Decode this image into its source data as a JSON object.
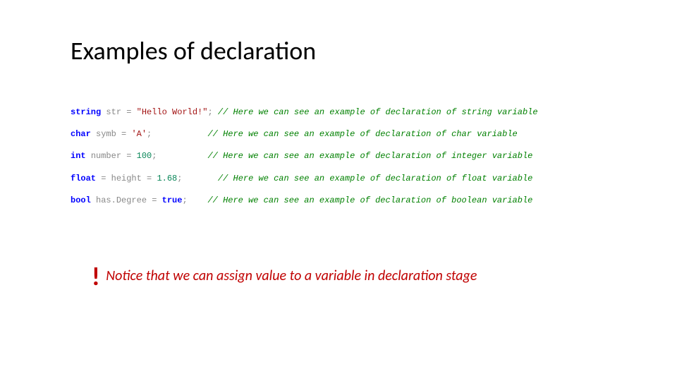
{
  "title": "Examples of declaration",
  "code": {
    "l1": {
      "kw": "string",
      "sp1": " ",
      "id": "str",
      "sp2": " ",
      "op": "=",
      "sp3": " ",
      "val": "\"Hello World!\"",
      "semi": ";",
      "pad": " ",
      "cmt": "// Here we can see an example of declaration of string variable"
    },
    "l2": {
      "kw": "char",
      "sp1": " ",
      "id": "symb",
      "sp2": " ",
      "op": "=",
      "sp3": " ",
      "val": "'A'",
      "semi": ";",
      "pad": "           ",
      "cmt": "// Here we can see an example of declaration of char variable"
    },
    "l3": {
      "kw": "int",
      "sp1": " ",
      "id": "number",
      "sp2": " ",
      "op": "=",
      "sp3": " ",
      "val": "100",
      "semi": ";",
      "pad": "          ",
      "cmt": "// Here we can see an example of declaration of integer variable"
    },
    "l4": {
      "kw": "float",
      "sp1": " ",
      "op1": "=",
      "sp2": " ",
      "id": "height",
      "sp3": " ",
      "op2": "=",
      "sp4": " ",
      "val": "1.68",
      "semi": ";",
      "pad": "       ",
      "cmt": "// Here we can see an example of declaration of float variable"
    },
    "l5": {
      "kw": "bool",
      "sp1": " ",
      "id": "has.Degree",
      "sp2": " ",
      "op": "=",
      "sp3": " ",
      "val": "true",
      "semi": ";",
      "pad": "    ",
      "cmt": "// Here we can see an example of declaration of boolean variable"
    }
  },
  "note": {
    "bang": "!",
    "text": " Notice that we can assign value to a variable in declaration stage"
  }
}
